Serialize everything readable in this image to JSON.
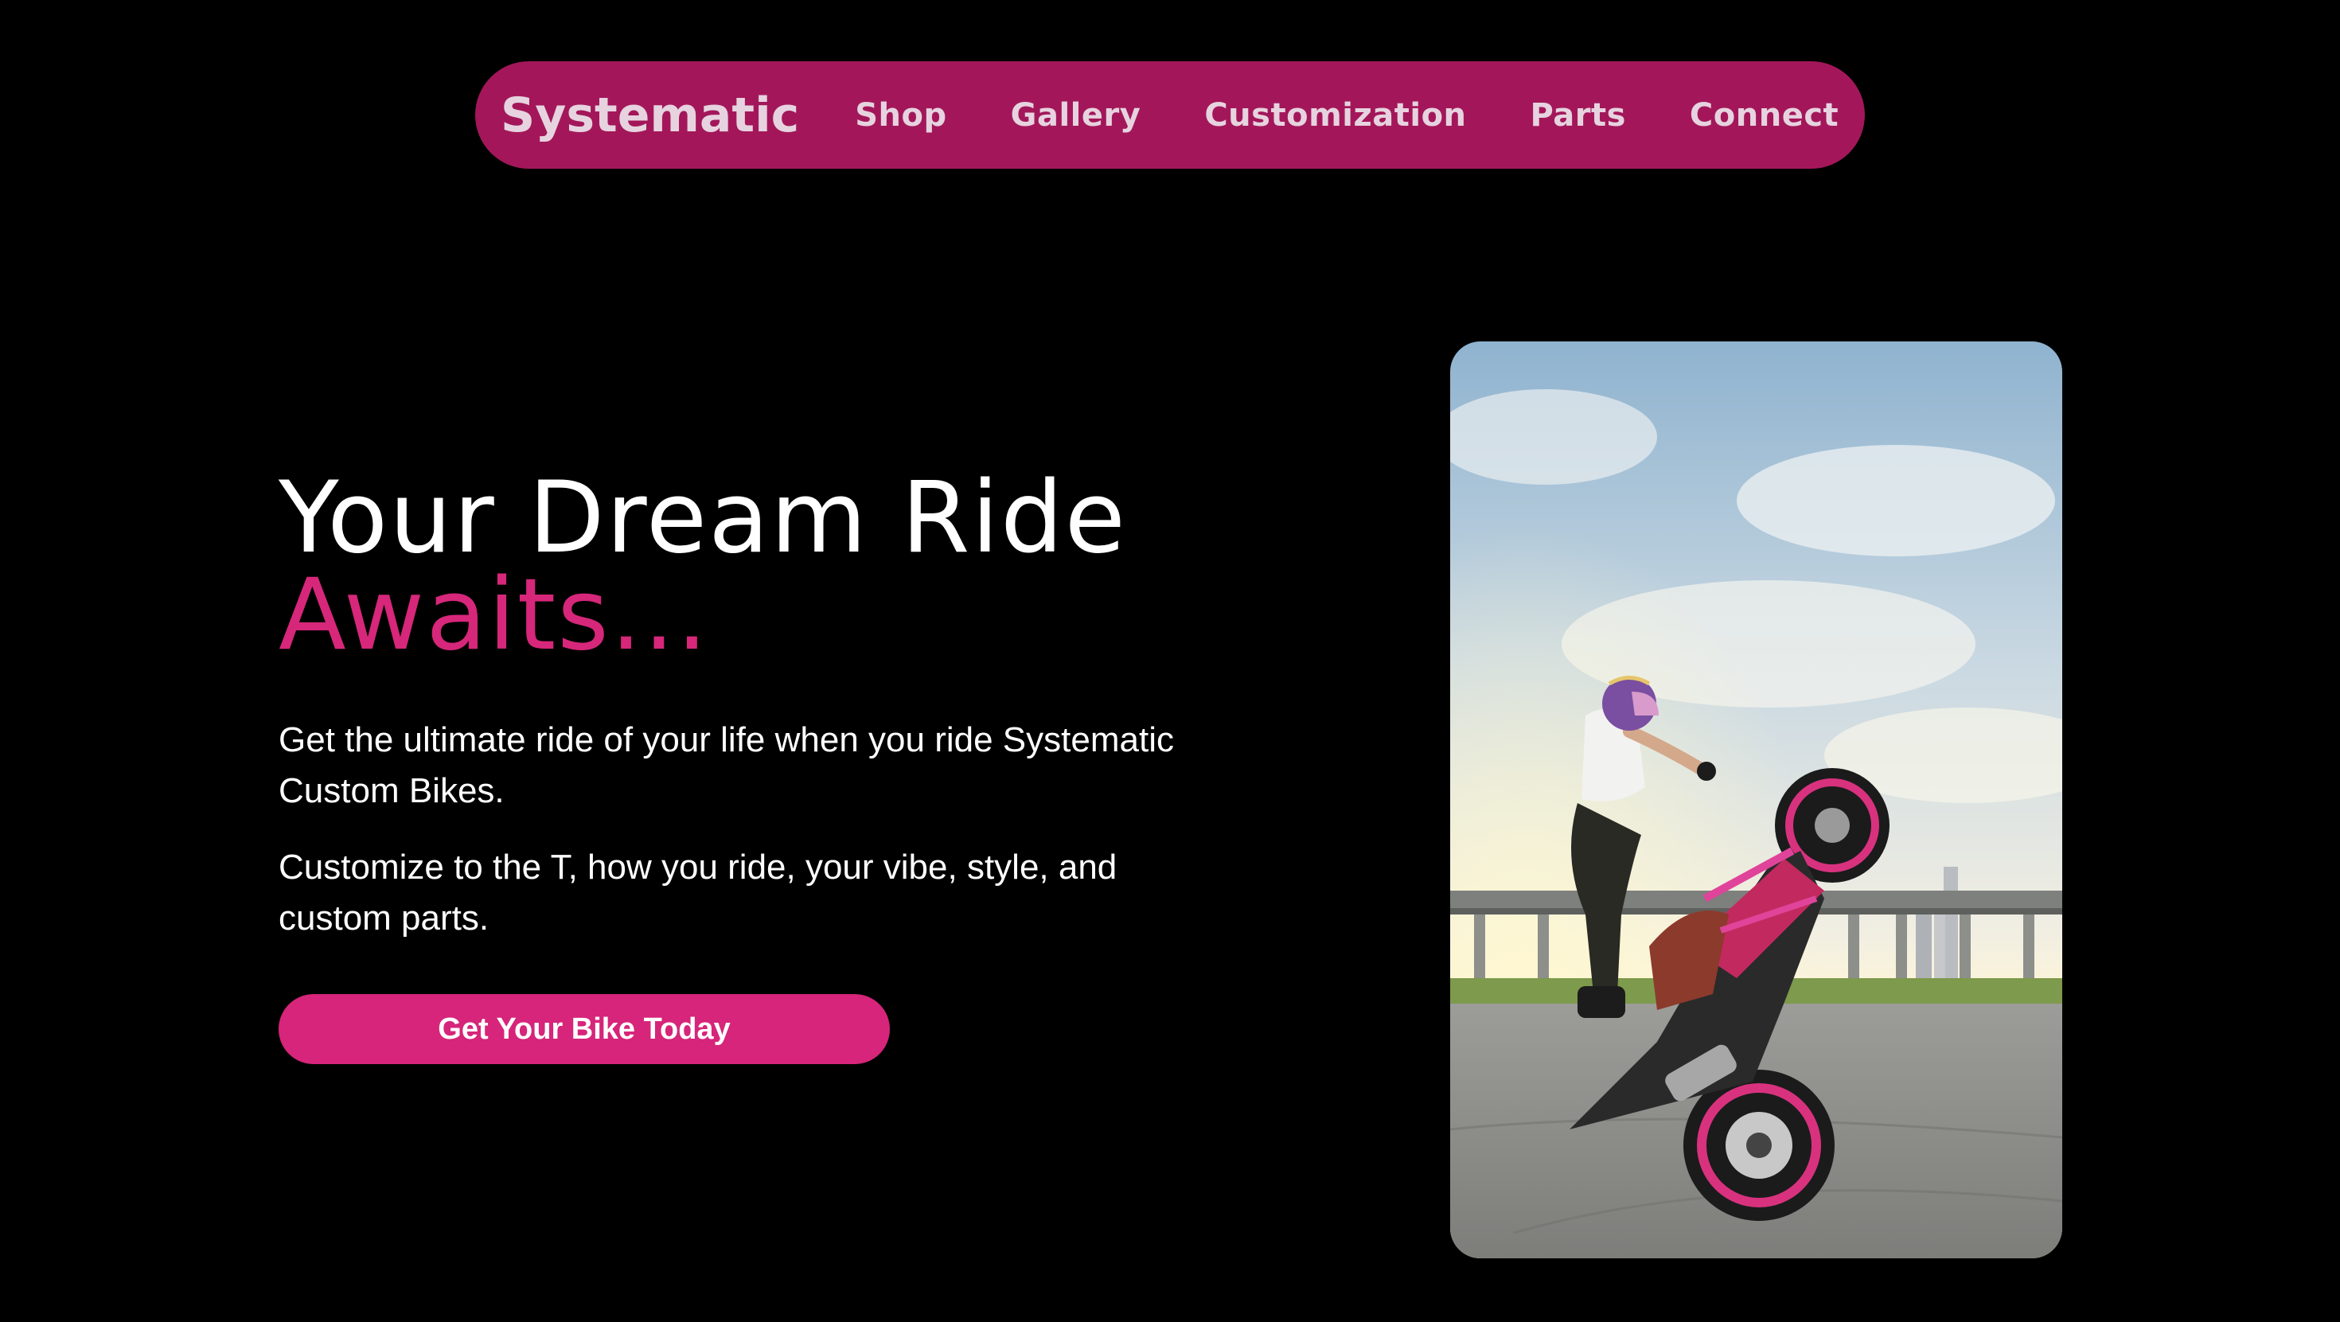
{
  "nav": {
    "brand": "Systematic",
    "links": [
      "Shop",
      "Gallery",
      "Customization",
      "Parts",
      "Connect"
    ]
  },
  "hero": {
    "title_line1": "Your Dream Ride",
    "title_line2": "Awaits...",
    "paragraph1": "Get the ultimate ride of your life when you ride Systematic Custom Bikes.",
    "paragraph2": "Customize to the T, how you ride, your vibe, style, and custom parts.",
    "cta_label": "Get Your Bike Today"
  },
  "colors": {
    "background": "#000000",
    "nav_bg": "#a3175a",
    "nav_text": "#e6d3df",
    "accent": "#d6277a"
  }
}
